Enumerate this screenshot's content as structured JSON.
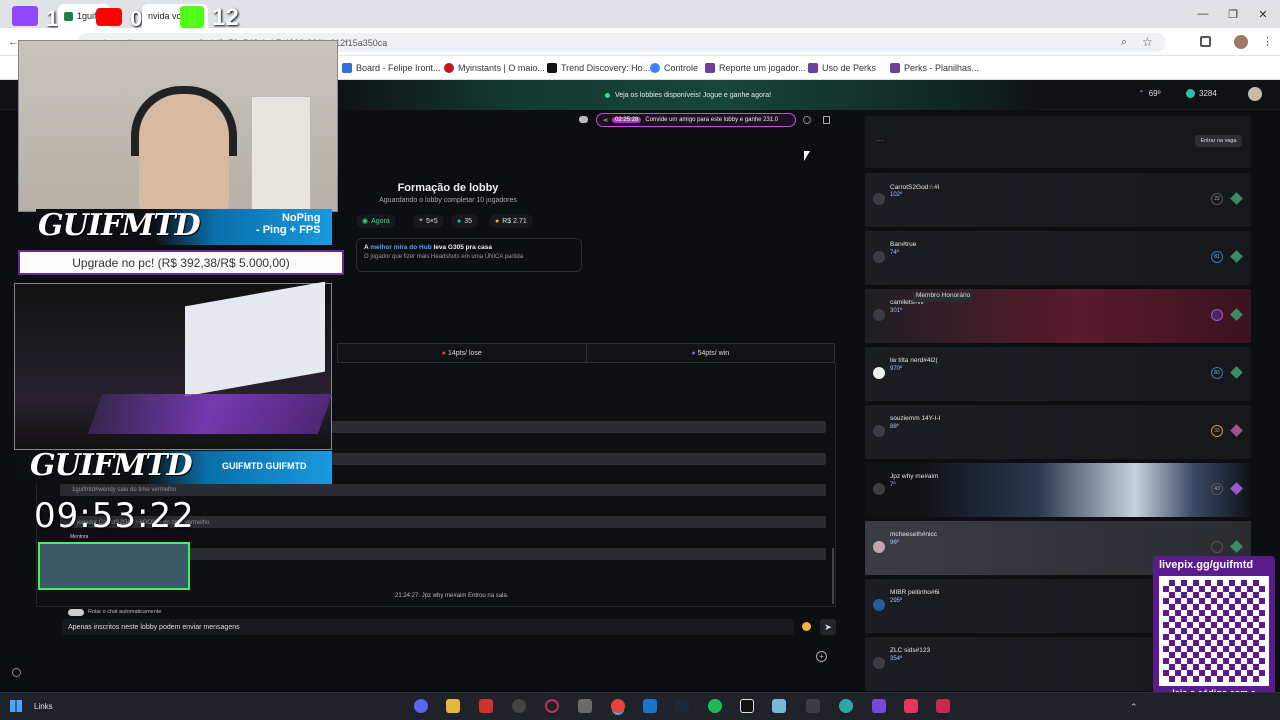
{
  "browser": {
    "tabs": [
      {
        "label": "1guif",
        "active": false
      },
      {
        "label": "nvida vo",
        "active": true
      }
    ],
    "overlay_counts": {
      "left": "1",
      "middle": "0",
      "right": "12"
    },
    "url": "https://gcpp.mentora.gg/hub/3c50a548-1eb7-4238-800b-312f15a350ca",
    "bookmarks": [
      {
        "label": "Board - Felipe Iront...",
        "color": "#2f6fd6"
      },
      {
        "label": "Myinstants | O maio...",
        "color": "#c0181f"
      },
      {
        "label": "Trend Discovery: Ho...",
        "color": "#111111"
      },
      {
        "label": "Controle",
        "color": "#3b82f6"
      },
      {
        "label": "Reporte um jogador...",
        "color": "#6b3fa0"
      },
      {
        "label": "Uso de Perks",
        "color": "#6b3fa0"
      },
      {
        "label": "Perks - Planilhas...",
        "color": "#6b3fa0"
      }
    ]
  },
  "site": {
    "banner": "Veja os lobbies disponíveis! Jogue e ganhe agora!",
    "header_stat1": "69º",
    "header_stat2": "3284",
    "invite_timer": "02:25:28",
    "invite_text": "Convide um amigo para este lobby e ganhe 231.0",
    "lobby_title": "Formação de lobby",
    "lobby_subtitle": "Aguardando o lobby completar 10 jogadores",
    "chips": [
      "Agora",
      "5×5",
      "35",
      "R$ 2.71"
    ],
    "promo_line1_prefix": "A ",
    "promo_highlight": "melhor mira do Hub",
    "promo_line1_suffix": " leva G305 pra casa",
    "promo_line2": "O jogador que fizer mais Headshots em uma ÚNICA partida",
    "teams": [
      "14pts/ lose",
      "54pts/ win"
    ],
    "chat_messages": [
      "",
      "",
      "1guifmtd#wendy saiu do time vermelho",
      "o jogador CarrotS2God☆#GOWP do time vermelho",
      ""
    ],
    "chat_system": "21:24:27: Jpz why me#aim Entrou na sala.",
    "chat_autoscroll": "Rolar o chat automaticamente",
    "chat_input_placeholder": "Apenas inscritos neste lobby podem enviar mensagens",
    "mentora_label": "Mentora",
    "enter_queue": "Entrar na vaga",
    "tooltip": "Membro Honorário",
    "players": [
      {
        "name": "CarrotS2God☆#l",
        "level": "102º",
        "badge": "22",
        "diamond": "#3c8a65"
      },
      {
        "name": "Ban#true",
        "level": "74º",
        "badge": "81",
        "diamond": "#3c8a65"
      },
      {
        "name": "camilets#vlr",
        "level": "301º",
        "badge": "",
        "diamond": "#3c8a65"
      },
      {
        "name": "tw tilta nerd#4i2(",
        "level": "970º",
        "badge": "83",
        "diamond": "#3c8a65"
      },
      {
        "name": "souziemm 14Y-I-I",
        "level": "88º",
        "badge": "33",
        "diamond": "#a0528a"
      },
      {
        "name": "Jpz why me#aim",
        "level": "7º",
        "badge": "43",
        "diamond": "#9a58d0"
      },
      {
        "name": "mcheeseth#nicc",
        "level": "96º",
        "badge": "",
        "diamond": "#3c8a65"
      },
      {
        "name": "MIBR peitinho#6i",
        "level": "295º",
        "badge": "",
        "diamond": "#3c8a65"
      },
      {
        "name": "ZLC sids#123",
        "level": "354º",
        "badge": "",
        "diamond": "#3c8a65"
      }
    ]
  },
  "stream": {
    "logo": "GUIFMTD",
    "noping": "NoPing",
    "noping_sub": "- Ping + FPS",
    "goal": "Upgrade no pc! (R$ 392,38/R$ 5.000,00)",
    "socials": "GUIFMTD  GUIFMTD",
    "clock": "09:53:22",
    "qr_url": "livepix.gg/guifmtd",
    "qr_caption": "leia o código com a câmera do celular."
  },
  "taskbar": {
    "links": "Links"
  }
}
